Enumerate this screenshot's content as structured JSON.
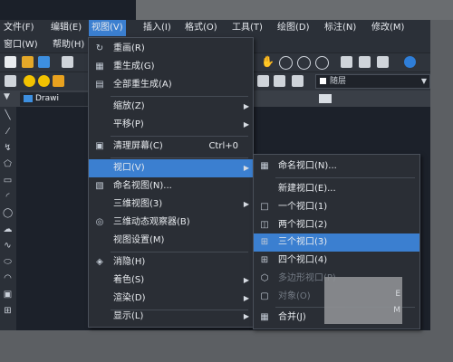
{
  "menubar": {
    "row1": [
      "文件(F)",
      "编辑(E)",
      "视图(V)",
      "插入(I)",
      "格式(O)",
      "工具(T)",
      "绘图(D)",
      "标注(N)",
      "修改(M)"
    ],
    "row2": [
      "窗口(W)",
      "帮助(H)"
    ]
  },
  "toolbar": {
    "layer_combo": "随层"
  },
  "doc_tab": {
    "label": "Drawi"
  },
  "view_menu": {
    "items": [
      {
        "label": "重画(R)"
      },
      {
        "label": "重生成(G)"
      },
      {
        "label": "全部重生成(A)"
      },
      {
        "label": "缩放(Z)"
      },
      {
        "label": "平移(P)"
      },
      {
        "label": "清理屏幕(C)",
        "shortcut": "Ctrl+0"
      },
      {
        "label": "视口(V)"
      },
      {
        "label": "命名视图(N)..."
      },
      {
        "label": "三维视图(3)"
      },
      {
        "label": "三维动态观察器(B)"
      },
      {
        "label": "视图设置(M)"
      },
      {
        "label": "消隐(H)"
      },
      {
        "label": "着色(S)"
      },
      {
        "label": "渲染(D)"
      },
      {
        "label": "显示(L)"
      }
    ]
  },
  "viewport_submenu": {
    "items": [
      {
        "label": "命名视口(N)..."
      },
      {
        "label": "新建视口(E)..."
      },
      {
        "label": "一个视口(1)"
      },
      {
        "label": "两个视口(2)"
      },
      {
        "label": "三个视口(3)"
      },
      {
        "label": "四个视口(4)"
      },
      {
        "label": "多边形视口(P)"
      },
      {
        "label": "对象(O)"
      },
      {
        "label": "合并(J)"
      }
    ],
    "ghost_text": [
      "E",
      "M"
    ]
  }
}
